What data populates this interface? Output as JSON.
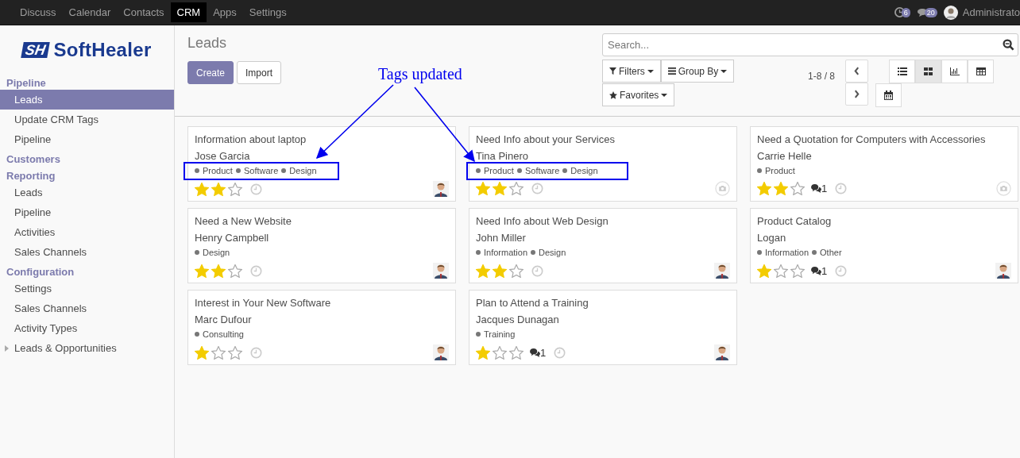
{
  "top_menu": [
    {
      "label": "Discuss",
      "selected": false
    },
    {
      "label": "Calendar",
      "selected": false
    },
    {
      "label": "Contacts",
      "selected": false
    },
    {
      "label": "CRM",
      "selected": true
    },
    {
      "label": "Apps",
      "selected": false
    },
    {
      "label": "Settings",
      "selected": false
    }
  ],
  "systray": {
    "activity_count": "6",
    "message_count": "20",
    "user": "Administrato"
  },
  "logo": {
    "mark": "SH",
    "name": "SoftHealer"
  },
  "sidebar": [
    {
      "heading": "Pipeline",
      "items": [
        {
          "label": "Leads",
          "selected": true,
          "kind": "link"
        },
        {
          "label": "Update CRM Tags",
          "selected": false,
          "kind": "link"
        },
        {
          "label": "Pipeline",
          "selected": false,
          "kind": "link"
        }
      ]
    },
    {
      "heading": "Customers"
    },
    {
      "heading": "Reporting",
      "items": [
        {
          "label": "Leads",
          "selected": false,
          "kind": "link"
        },
        {
          "label": "Pipeline",
          "selected": false,
          "kind": "link"
        },
        {
          "label": "Activities",
          "selected": false,
          "kind": "link"
        },
        {
          "label": "Sales Channels",
          "selected": false,
          "kind": "link"
        }
      ]
    },
    {
      "heading": "Configuration",
      "items": [
        {
          "label": "Settings",
          "selected": false,
          "kind": "link"
        },
        {
          "label": "Sales Channels",
          "selected": false,
          "kind": "link"
        },
        {
          "label": "Activity Types",
          "selected": false,
          "kind": "link"
        },
        {
          "label": "Leads & Opportunities",
          "selected": false,
          "kind": "folder"
        }
      ]
    }
  ],
  "control_panel": {
    "title": "Leads",
    "buttons": [
      {
        "label": "Create",
        "kind": "primary"
      },
      {
        "label": "Import",
        "kind": "secondary"
      }
    ],
    "search": {
      "placeholder": "Search..."
    },
    "filters": [
      {
        "label": "Filters",
        "kind": "filter"
      },
      {
        "label": "Group By",
        "kind": "group"
      },
      {
        "label": "Favorites",
        "kind": "star"
      }
    ],
    "pager": "1-8 / 8",
    "views": [
      {
        "kind": "list",
        "selected": false
      },
      {
        "kind": "kanban",
        "selected": true
      },
      {
        "kind": "graph",
        "selected": false
      },
      {
        "kind": "pivot",
        "selected": false
      },
      {
        "kind": "calendar",
        "selected": false
      }
    ]
  },
  "cards": [
    {
      "kind": "photo",
      "title": "Information about laptop",
      "customer": "Jose Garcia",
      "tags": [
        "Product",
        "Software",
        "Design"
      ],
      "stars": 2
    },
    {
      "kind": "placeholder",
      "title": "Need Info about your Services",
      "customer": "Tina Pinero",
      "tags": [
        "Product",
        "Software",
        "Design"
      ],
      "stars": 2
    },
    {
      "kind": "placeholder",
      "title": "Need a Quotation for Computers with Accessories",
      "customer": "Carrie Helle",
      "tags": [
        "Product"
      ],
      "stars": 2,
      "messages": "1"
    },
    {
      "kind": "photo",
      "title": "Need a New Website",
      "customer": "Henry Campbell",
      "tags": [
        "Design"
      ],
      "stars": 2
    },
    {
      "kind": "photo",
      "title": "Need Info about Web Design",
      "customer": "John Miller",
      "tags": [
        "Information",
        "Design"
      ],
      "stars": 2
    },
    {
      "kind": "photo",
      "title": "Product Catalog",
      "customer": "Logan",
      "tags": [
        "Information",
        "Other"
      ],
      "stars": 1,
      "messages": "1"
    },
    {
      "kind": "photo",
      "title": "Interest in Your New Software",
      "customer": "Marc Dufour",
      "tags": [
        "Consulting"
      ],
      "stars": 1
    },
    {
      "kind": "photo",
      "title": "Plan to Attend a Training",
      "customer": "Jacques Dunagan",
      "tags": [
        "Training"
      ],
      "stars": 1,
      "messages": "1"
    }
  ],
  "annotation": {
    "text": "Tags updated"
  }
}
